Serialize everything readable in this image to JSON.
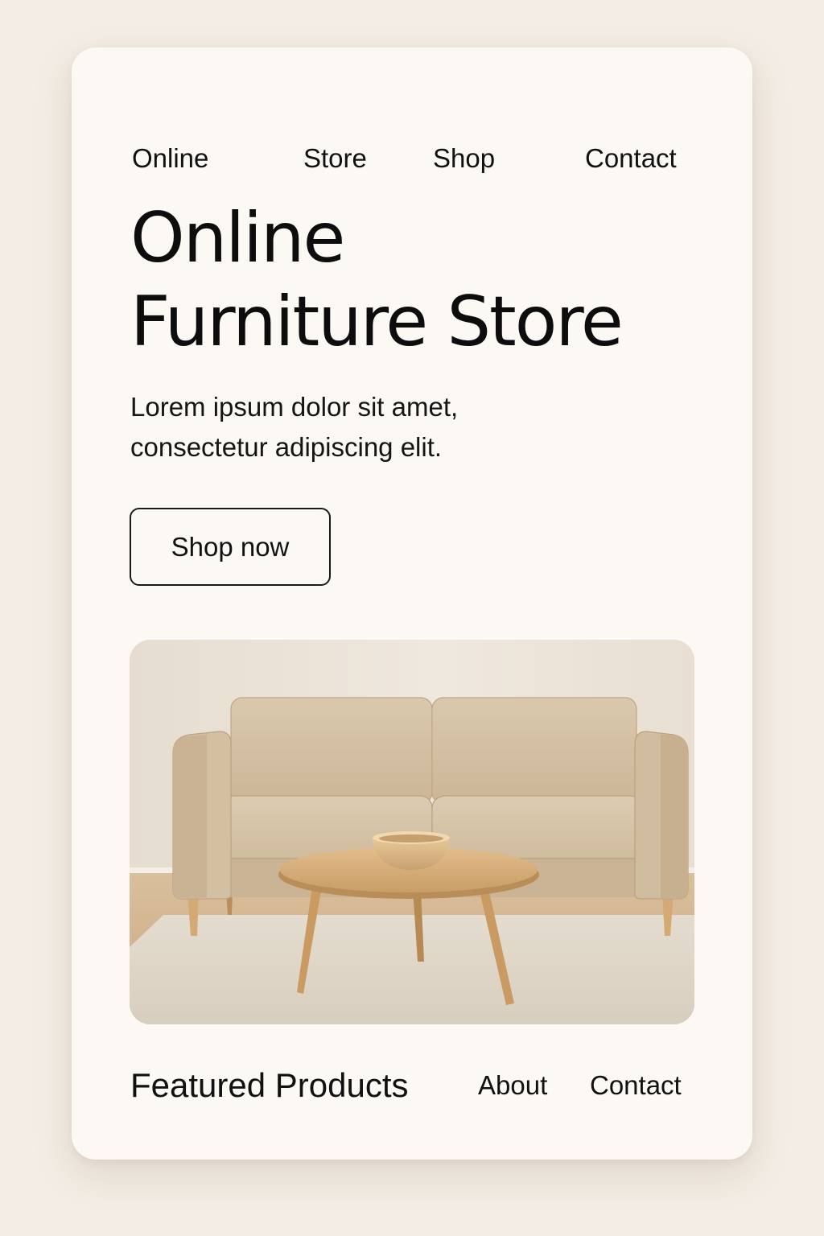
{
  "nav": {
    "items": [
      {
        "label": "Online"
      },
      {
        "label": "Store"
      },
      {
        "label": "Shop"
      },
      {
        "label": "Contact"
      }
    ]
  },
  "hero": {
    "title_line1": "Online",
    "title_line2": "Furniture Store",
    "subtitle_line1": "Lorem ipsum dolor sit amet,",
    "subtitle_line2": "consectetur adipiscing elit.",
    "button_label": "Shop now"
  },
  "footer": {
    "featured_label": "Featured Products",
    "about_label": "About",
    "contact_label": "Contact"
  },
  "colors": {
    "page_background": "#f3ede5",
    "card_background": "#fcf8f4",
    "text": "#111111",
    "sofa": "#d6c3a6",
    "wood": "#d2a772"
  }
}
